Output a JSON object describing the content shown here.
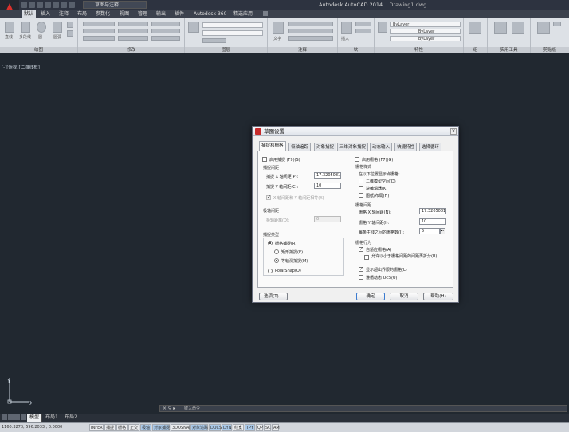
{
  "titlebar": {
    "workspace": "草图与注释",
    "app_title": "Autodesk AutoCAD 2014",
    "doc_title": "Drawing1.dwg"
  },
  "ribbon_tabs": [
    "默认",
    "插入",
    "注释",
    "布局",
    "参数化",
    "视图",
    "管理",
    "输出",
    "插件",
    "Autodesk 360",
    "精选应用"
  ],
  "ribbon": {
    "panels": [
      "绘图",
      "修改",
      "图层",
      "注释",
      "块",
      "特性",
      "组",
      "实用工具",
      "剪贴板"
    ],
    "draw_tools": [
      "直线",
      "多段线",
      "圆",
      "圆弧"
    ],
    "annotation_tool": "文字",
    "insert_tool": "插入",
    "properties": {
      "color": "ByLayer",
      "linetype": "ByLayer",
      "lineweight": "ByLayer"
    }
  },
  "viewport": {
    "label": "[-][俯视][二维线框]",
    "ucs_y": "Y",
    "ucs_x": "X"
  },
  "command_line": {
    "prompt": "键入命令"
  },
  "layout_tabs": [
    "模型",
    "布局1",
    "布局2"
  ],
  "status": {
    "coords": "1160.3273, 596.2033 , 0.0000",
    "buttons": [
      {
        "label": "INFER",
        "on": false
      },
      {
        "label": "捕捉",
        "on": false
      },
      {
        "label": "栅格",
        "on": false
      },
      {
        "label": "正交",
        "on": false
      },
      {
        "label": "极轴",
        "on": true
      },
      {
        "label": "对象捕捉",
        "on": true
      },
      {
        "label": "3DOSNAP",
        "on": false
      },
      {
        "label": "对象追踪",
        "on": true
      },
      {
        "label": "DUCS",
        "on": true
      },
      {
        "label": "DYN",
        "on": true
      },
      {
        "label": "线宽",
        "on": false
      },
      {
        "label": "TPY",
        "on": true
      },
      {
        "label": "QP",
        "on": false
      },
      {
        "label": "SC",
        "on": false
      },
      {
        "label": "AM",
        "on": false
      }
    ]
  },
  "dialog": {
    "title": "草图设置",
    "close": "×",
    "tabs": [
      "捕捉和栅格",
      "极轴追踪",
      "对象捕捉",
      "三维对象捕捉",
      "动态输入",
      "快捷特性",
      "选择循环"
    ],
    "snap_on": "启用捕捉 (F9)(S)",
    "snap_spacing": "捕捉间距",
    "snap_x_label": "捕捉 X 轴间距(P):",
    "snap_x_value": "17.3205081",
    "snap_y_label": "捕捉 Y 轴间距(C):",
    "snap_y_value": "10",
    "xy_equal": "X 轴间距和 Y 轴间距相等(X)",
    "polar_spacing": "极轴间距",
    "polar_distance_label": "极轴距离(D):",
    "polar_distance_value": "0",
    "snap_type": "捕捉类型",
    "grid_snap": "栅格捕捉(R)",
    "rect_snap": "矩形捕捉(E)",
    "iso_snap": "等轴测捕捉(M)",
    "polar_snap": "PolarSnap(O)",
    "grid_on": "启用栅格 (F7)(G)",
    "grid_style": "栅格样式",
    "grid_style_desc": "在以下位置显示点栅格:",
    "grid_2d": "二维模型空间(D)",
    "grid_block": "块编辑器(K)",
    "grid_sheet": "图纸/布局(H)",
    "grid_spacing": "栅格间距",
    "grid_x_label": "栅格 X 轴间距(N):",
    "grid_x_value": "17.3205081",
    "grid_y_label": "栅格 Y 轴间距(I):",
    "grid_y_value": "10",
    "major_label": "每条主线之间的栅格数(J):",
    "major_value": "5",
    "grid_behavior": "栅格行为",
    "adaptive": "自适应栅格(A)",
    "subdivide": "允许以小于栅格间距的间距再拆分(B)",
    "beyond_limits": "显示超出界限的栅格(L)",
    "follow_ucs": "遵循动态 UCS(U)",
    "options_btn": "选项(T)...",
    "ok_btn": "确定",
    "cancel_btn": "取消",
    "help_btn": "帮助(H)"
  }
}
